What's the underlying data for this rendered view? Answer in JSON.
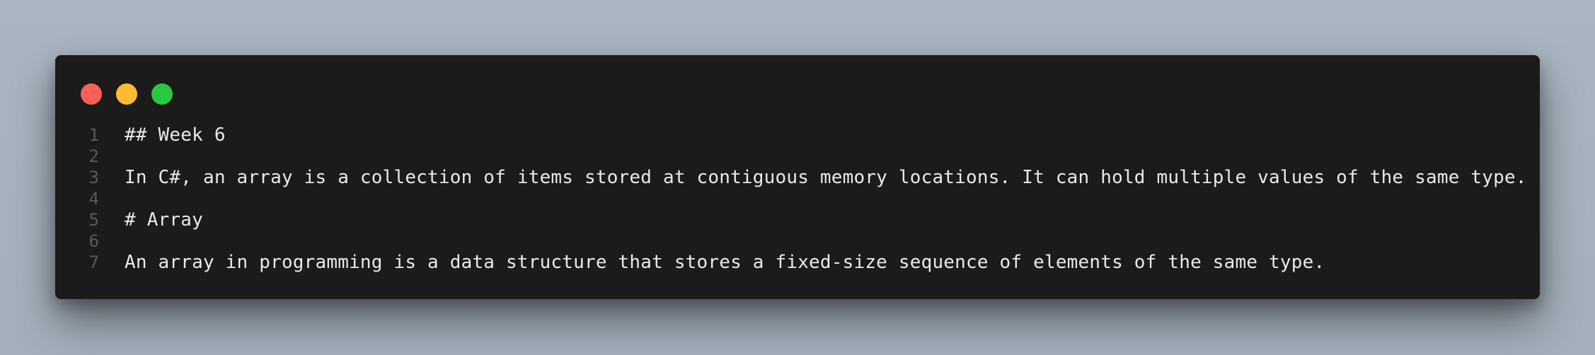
{
  "window": {
    "controls": {
      "close_color": "#ff5f57",
      "minimize_color": "#febc2e",
      "maximize_color": "#28c840"
    }
  },
  "code": {
    "lines": [
      {
        "number": "1",
        "text": "## Week 6"
      },
      {
        "number": "2",
        "text": ""
      },
      {
        "number": "3",
        "text": "In C#, an array is a collection of items stored at contiguous memory locations. It can hold multiple values of the same type."
      },
      {
        "number": "4",
        "text": ""
      },
      {
        "number": "5",
        "text": "# Array"
      },
      {
        "number": "6",
        "text": ""
      },
      {
        "number": "7",
        "text": "An array in programming is a data structure that stores a fixed-size sequence of elements of the same type."
      }
    ]
  }
}
